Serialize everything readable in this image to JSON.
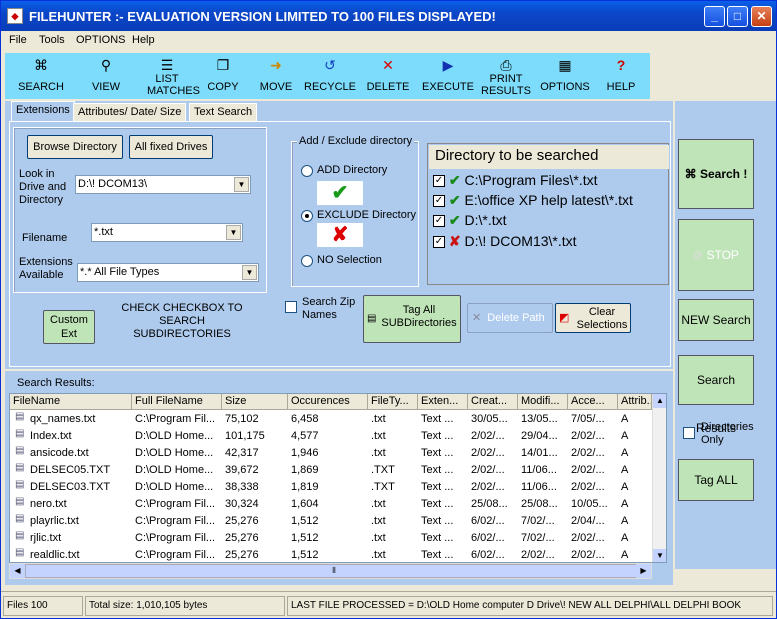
{
  "window": {
    "title": "FILEHUNTER :- EVALUATION VERSION LIMITED TO 100 FILES DISPLAYED!"
  },
  "menu": [
    "File",
    "Tools",
    "OPTIONS",
    "Help"
  ],
  "toolbar": [
    {
      "label": "SEARCH",
      "icon": "binoculars-icon"
    },
    {
      "label": "VIEW",
      "icon": "magnifier-icon"
    },
    {
      "label": "LIST MATCHES",
      "icon": "list-icon"
    },
    {
      "label": "COPY",
      "icon": "copy-icon"
    },
    {
      "label": "MOVE",
      "icon": "move-icon"
    },
    {
      "label": "RECYCLE",
      "icon": "recycle-icon"
    },
    {
      "label": "DELETE",
      "icon": "delete-icon"
    },
    {
      "label": "EXECUTE",
      "icon": "execute-icon"
    },
    {
      "label": "PRINT RESULTS",
      "icon": "printer-icon"
    },
    {
      "label": "OPTIONS",
      "icon": "options-icon"
    },
    {
      "label": "HELP",
      "icon": "help-icon"
    }
  ],
  "tabs": [
    "Extensions",
    "Attributes/ Date/ Size",
    "Text Search"
  ],
  "extensions": {
    "browse_label": "Browse Directory",
    "fixed_label": "All fixed Drives",
    "look_in_label": "Look in Drive and Directory",
    "look_in_value": "D:\\! DCOM13\\",
    "filename_label": "Filename",
    "filename_value": "*.txt",
    "ext_label": "Extensions Available",
    "ext_value": "*.* All File Types",
    "custom_label": "Custom Ext",
    "check_note": "CHECK CHECKBOX TO SEARCH SUBDIRECTORIES"
  },
  "add_exclude": {
    "title": "Add / Exclude directory",
    "add": "ADD Directory",
    "exclude": "EXCLUDE Directory",
    "none": "NO Selection"
  },
  "dirlist": {
    "header": "Directory to be searched",
    "items": [
      {
        "path": "C:\\Program Files\\*.txt",
        "mark": "✔",
        "color": "#1a8a1a"
      },
      {
        "path": "E:\\office XP help latest\\*.txt",
        "mark": "✔",
        "color": "#1a8a1a"
      },
      {
        "path": "D:\\*.txt",
        "mark": "✔",
        "color": "#1a8a1a"
      },
      {
        "path": "D:\\! DCOM13\\*.txt",
        "mark": "✘",
        "color": "#cc1111"
      }
    ]
  },
  "search_zip": "Search Zip Names",
  "tag_all_sub": "Tag All SUBDirectories",
  "delete_path": "Delete Path",
  "clear_selections": "Clear Selections",
  "right": {
    "search": "Search !",
    "stop": "STOP",
    "new_search": "NEW Search",
    "search_results": "Search Results",
    "dirs_only": "Directories Only",
    "tag_all": "Tag ALL"
  },
  "results": {
    "label": "Search Results:",
    "columns": [
      "FileName",
      "Full FileName",
      "Size",
      "Occurences",
      "FileTy...",
      "Exten...",
      "Creat...",
      "Modifi...",
      "Acce...",
      "Attrib..."
    ],
    "rows": [
      [
        "qx_names.txt",
        "C:\\Program Fil...",
        "75,102",
        "6,458",
        ".txt",
        "Text ...",
        "30/05...",
        "13/05...",
        "7/05/...",
        "A"
      ],
      [
        "Index.txt",
        "D:\\OLD Home...",
        "101,175",
        "4,577",
        ".txt",
        "Text ...",
        "2/02/...",
        "29/04...",
        "2/02/...",
        "A"
      ],
      [
        "ansicode.txt",
        "D:\\OLD Home...",
        "42,317",
        "1,946",
        ".txt",
        "Text ...",
        "2/02/...",
        "14/01...",
        "2/02/...",
        "A"
      ],
      [
        "DELSEC05.TXT",
        "D:\\OLD Home...",
        "39,672",
        "1,869",
        ".TXT",
        "Text ...",
        "2/02/...",
        "11/06...",
        "2/02/...",
        "A"
      ],
      [
        "DELSEC03.TXT",
        "D:\\OLD Home...",
        "38,338",
        "1,819",
        ".TXT",
        "Text ...",
        "2/02/...",
        "11/06...",
        "2/02/...",
        "A"
      ],
      [
        "nero.txt",
        "C:\\Program Fil...",
        "30,324",
        "1,604",
        ".txt",
        "Text ...",
        "25/08...",
        "25/08...",
        "10/05...",
        "A"
      ],
      [
        "playrlic.txt",
        "C:\\Program Fil...",
        "25,276",
        "1,512",
        ".txt",
        "Text ...",
        "6/02/...",
        "7/02/...",
        "2/04/...",
        "A"
      ],
      [
        "rjlic.txt",
        "C:\\Program Fil...",
        "25,276",
        "1,512",
        ".txt",
        "Text ...",
        "6/02/...",
        "7/02/...",
        "2/02/...",
        "A"
      ],
      [
        "realdlic.txt",
        "C:\\Program Fil...",
        "25,276",
        "1,512",
        ".txt",
        "Text ...",
        "6/02/...",
        "2/02/...",
        "2/02/...",
        "A"
      ]
    ]
  },
  "status": {
    "files": "Files 100",
    "total": "Total size: 1,010,105 bytes",
    "last": "LAST FILE PROCESSED  =  D:\\OLD Home computer D Drive\\! NEW ALL DELPHI\\ALL DELPHI BOOK"
  }
}
